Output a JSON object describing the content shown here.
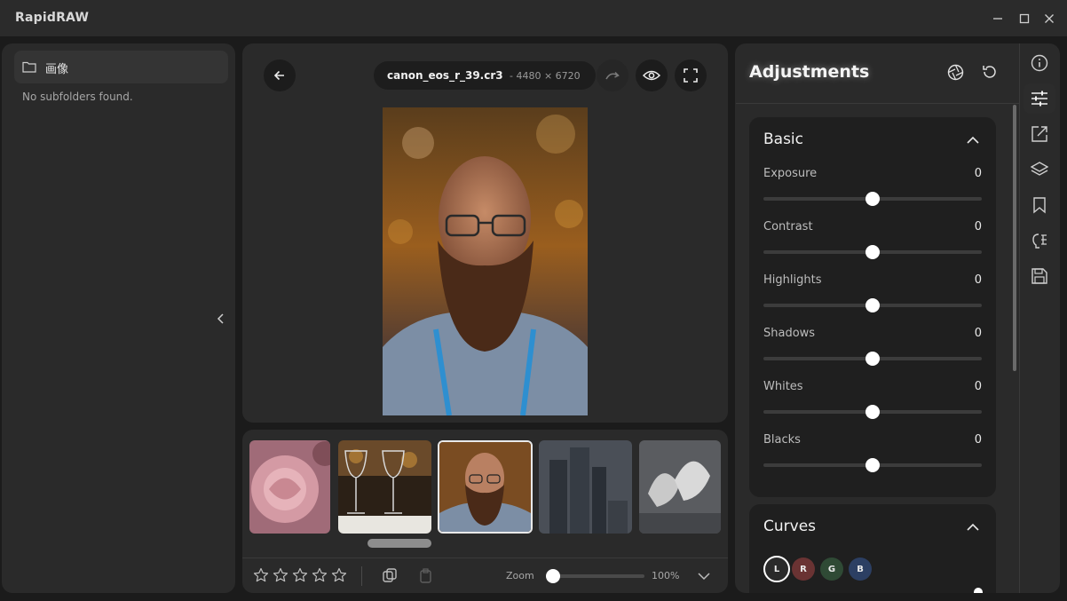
{
  "window": {
    "title": "RapidRAW"
  },
  "folders": {
    "current": "画像",
    "empty_message": "No subfolders found."
  },
  "viewer": {
    "filename": "canon_eos_r_39.cr3",
    "dimensions": "- 4480 × 6720"
  },
  "filmstrip": {
    "thumbnails": [
      {
        "subject": "pink rose"
      },
      {
        "subject": "wine glasses"
      },
      {
        "subject": "bearded man portrait",
        "selected": true
      },
      {
        "subject": "skyscrapers"
      },
      {
        "subject": "seagulls"
      }
    ],
    "rating": 0,
    "rating_max": 5
  },
  "zoom": {
    "label": "Zoom",
    "value": "100%"
  },
  "adjustments": {
    "title": "Adjustments",
    "basic": {
      "title": "Basic",
      "sliders": [
        {
          "label": "Exposure",
          "value": "0"
        },
        {
          "label": "Contrast",
          "value": "0"
        },
        {
          "label": "Highlights",
          "value": "0"
        },
        {
          "label": "Shadows",
          "value": "0"
        },
        {
          "label": "Whites",
          "value": "0"
        },
        {
          "label": "Blacks",
          "value": "0"
        }
      ]
    },
    "curves": {
      "title": "Curves",
      "channels": [
        "L",
        "R",
        "G",
        "B"
      ]
    }
  },
  "colors": {
    "accent": "#ffffff",
    "panel": "#2a2a2a",
    "channel_r": "#6a3333",
    "channel_g": "#2f4a35",
    "channel_b": "#2c3f63"
  },
  "tools": [
    "info-icon",
    "sliders-icon",
    "export-icon",
    "layers-icon",
    "bookmark-icon",
    "ai-mask-icon",
    "save-icon"
  ]
}
